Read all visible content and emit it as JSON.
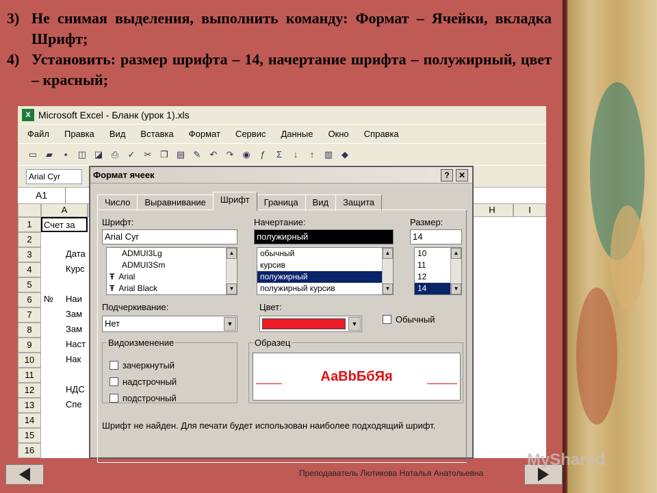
{
  "instructions": [
    {
      "num": "3)",
      "text": "Не снимая выделения, выполнить команду: Формат – Ячейки, вкладка Шрифт;"
    },
    {
      "num": "4)",
      "text": "Установить: размер шрифта – 14, начертание шрифта – полужирный, цвет – красный;"
    }
  ],
  "excel": {
    "title": "Microsoft Excel - Бланк (урок 1).xls",
    "menu": [
      "Файл",
      "Правка",
      "Вид",
      "Вставка",
      "Формат",
      "Сервис",
      "Данные",
      "Окно",
      "Справка"
    ],
    "font_box": "Arial Cyr",
    "name_box": "A1",
    "columns": [
      "A",
      "H",
      "I"
    ],
    "rows": [
      "1",
      "2",
      "3",
      "4",
      "5",
      "6",
      "7",
      "8",
      "9",
      "10",
      "11",
      "12",
      "13",
      "14",
      "15",
      "16"
    ],
    "cells": {
      "r1a": "Счет за",
      "r3b": "Дата",
      "r4b": "Курс",
      "r6a": "№",
      "r6b": "Наи",
      "r7b": "Зам",
      "r8b": "Зам",
      "r9b": "Наст",
      "r10b": "Нак",
      "r12b": "НДС",
      "r13b": "Спе"
    }
  },
  "dialog": {
    "title": "Формат ячеек",
    "help_btn": "?",
    "close_btn": "✕",
    "tabs": [
      "Число",
      "Выравнивание",
      "Шрифт",
      "Граница",
      "Вид",
      "Защита"
    ],
    "active_tab": "Шрифт",
    "font_label": "Шрифт:",
    "font_value": "Arial Cyr",
    "font_list": [
      "ADMUI3Lg",
      "ADMUI3Sm",
      "Arial",
      "Arial Black"
    ],
    "style_label": "Начертание:",
    "style_value": "полужирный",
    "style_list": [
      "обычный",
      "курсив",
      "полужирный",
      "полужирный курсив"
    ],
    "size_label": "Размер:",
    "size_value": "14",
    "size_list": [
      "10",
      "11",
      "12",
      "14"
    ],
    "underline_label": "Подчеркивание:",
    "underline_value": "Нет",
    "color_label": "Цвет:",
    "color_value": "#ee1c24",
    "normal_label": "Обычный",
    "effects_label": "Видоизменение",
    "effects": [
      "зачеркнутый",
      "надстрочный",
      "подстрочный"
    ],
    "sample_label": "Образец",
    "sample_text": "АаBbБбЯя",
    "note": "Шрифт не найден. Для печати будет использован наиболее подходящий шрифт."
  },
  "footer": {
    "author": "Преподаватель Лютикова Наталья Анатольевна",
    "watermark": "MyShared"
  },
  "colors": {
    "slide_bg": "#c05a55",
    "sample_red": "#e01010",
    "selection": "#0a246a"
  }
}
